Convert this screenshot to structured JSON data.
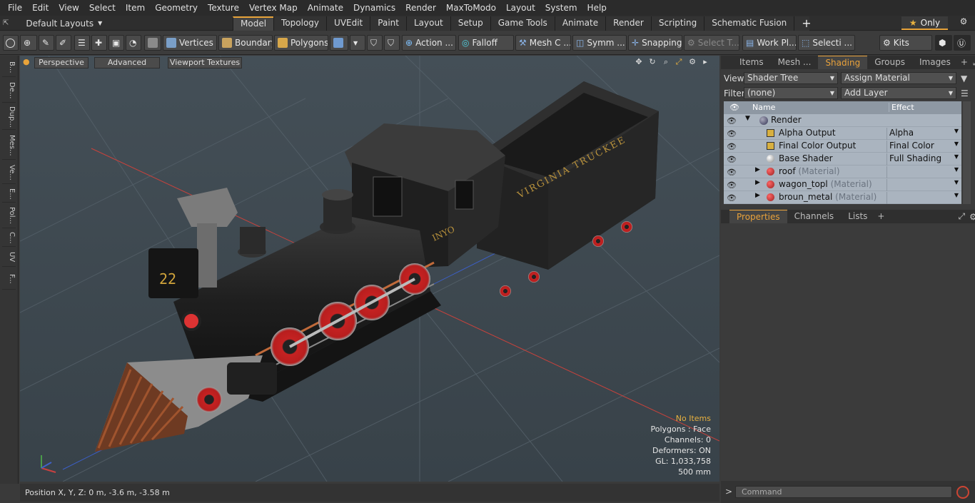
{
  "menubar": [
    "File",
    "Edit",
    "View",
    "Select",
    "Item",
    "Geometry",
    "Texture",
    "Vertex Map",
    "Animate",
    "Dynamics",
    "Render",
    "MaxToModo",
    "Layout",
    "System",
    "Help"
  ],
  "layout_selector": "Default Layouts",
  "tabs": [
    "Model",
    "Topology",
    "UVEdit",
    "Paint",
    "Layout",
    "Setup",
    "Game Tools",
    "Animate",
    "Render",
    "Scripting",
    "Schematic Fusion"
  ],
  "only_label": "Only",
  "toolbar": {
    "vertices": "Vertices",
    "boundary": "Boundary",
    "polygons": "Polygons",
    "action": "Action ...",
    "falloff": "Falloff",
    "mesh": "Mesh C ...",
    "symm": "Symm ...",
    "snapping": "Snapping",
    "select_t": "Select T...",
    "work_plane": "Work Pl...",
    "selecti": "Selecti ...",
    "kits": "Kits"
  },
  "left_tabs": [
    "B...",
    "De...",
    "Dup...",
    "Mes...",
    "Ve...",
    "E...",
    "Pol...",
    "C...",
    "UV",
    "F..."
  ],
  "viewport": {
    "perspective": "Perspective",
    "advanced": "Advanced",
    "textures": "Viewport Textures",
    "stats": {
      "no_items": "No Items",
      "polygons": "Polygons : Face",
      "channels": "Channels: 0",
      "deformers": "Deformers: ON",
      "gl": "GL: 1,033,758",
      "scale": "500 mm"
    }
  },
  "status": "Position X, Y, Z:   0 m, -3.6 m, -3.58 m",
  "right_tabs": [
    "Items",
    "Mesh ...",
    "Shading",
    "Groups",
    "Images"
  ],
  "shader": {
    "view_label": "View",
    "view_value": "Shader Tree",
    "assign": "Assign Material",
    "filter_label": "Filter",
    "filter_value": "(none)",
    "add_layer": "Add Layer",
    "col_name": "Name",
    "col_effect": "Effect",
    "rows": [
      {
        "name": "Render",
        "tag": "",
        "effect": ""
      },
      {
        "name": "Alpha Output",
        "tag": "",
        "effect": "Alpha"
      },
      {
        "name": "Final Color Output",
        "tag": "",
        "effect": "Final Color"
      },
      {
        "name": "Base Shader",
        "tag": "",
        "effect": "Full Shading"
      },
      {
        "name": "roof",
        "tag": "(Material)",
        "effect": ""
      },
      {
        "name": "wagon_topl",
        "tag": "(Material)",
        "effect": ""
      },
      {
        "name": "broun_metal",
        "tag": "(Material)",
        "effect": ""
      }
    ]
  },
  "properties_tabs": [
    "Properties",
    "Channels",
    "Lists"
  ],
  "command_placeholder": "Command",
  "colors": {
    "accent": "#e8a33a",
    "viewport_bg": "#3f4a52",
    "tree_bg": "#aab4bf"
  }
}
